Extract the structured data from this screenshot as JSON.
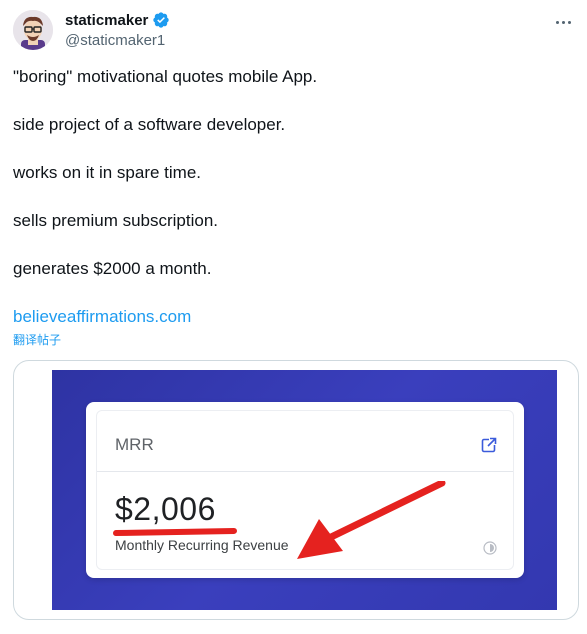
{
  "tweet": {
    "display_name": "staticmaker",
    "handle": "@staticmaker1",
    "lines": [
      "\"boring\" motivational quotes mobile App.",
      "side project of a software developer.",
      "works on it in spare time.",
      "sells premium subscription.",
      "generates $2000 a month."
    ],
    "link_text": "believeaffirmations.com",
    "translate_label": "翻译帖子"
  },
  "media": {
    "card_title": "MRR",
    "amount": "$2,006",
    "subtitle": "Monthly Recurring Revenue"
  },
  "colors": {
    "accent": "#1d9bf0",
    "media_bg": "#3a3fbd",
    "annotation_red": "#e5221f"
  },
  "icons": {
    "verified": "verified-badge-icon",
    "more": "more-options-icon",
    "external": "external-link-icon",
    "info": "info-icon"
  }
}
